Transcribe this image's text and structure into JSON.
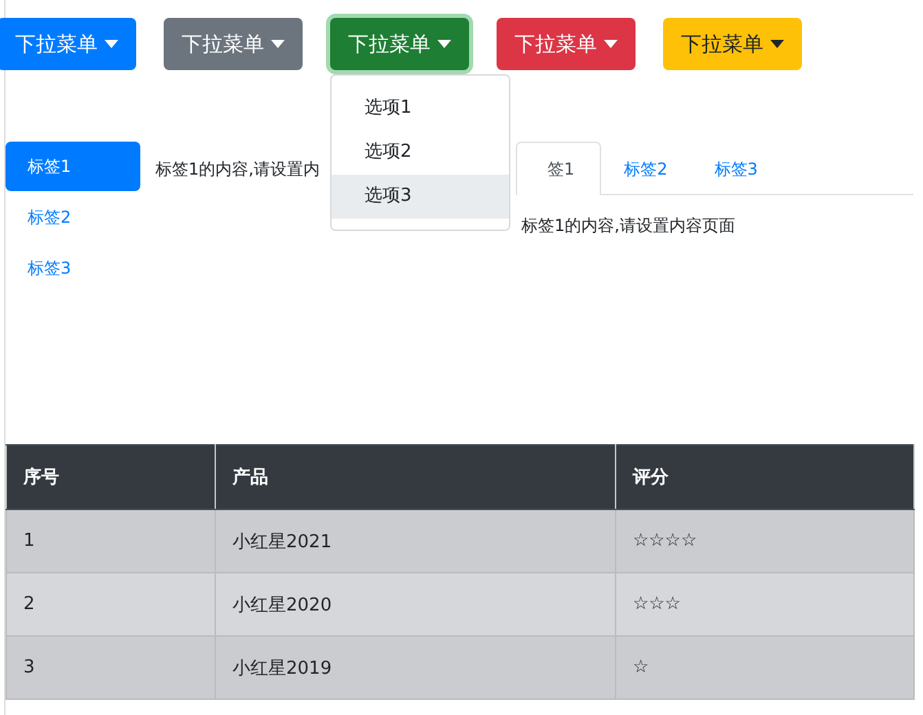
{
  "dropdowns": [
    {
      "label": "下拉菜单",
      "kind": "primary",
      "open": false
    },
    {
      "label": "下拉菜单",
      "kind": "secondary",
      "open": false
    },
    {
      "label": "下拉菜单",
      "kind": "success",
      "open": true
    },
    {
      "label": "下拉菜单",
      "kind": "danger",
      "open": false
    },
    {
      "label": "下拉菜单",
      "kind": "warning",
      "open": false
    }
  ],
  "dropdown_menu": {
    "items": [
      {
        "label": "选项1",
        "selected": false
      },
      {
        "label": "选项2",
        "selected": false
      },
      {
        "label": "选项3",
        "selected": true
      }
    ]
  },
  "pill_tabs": {
    "items": [
      {
        "label": "标签1",
        "selected": true
      },
      {
        "label": "标签2",
        "selected": false
      },
      {
        "label": "标签3",
        "selected": false
      }
    ],
    "content": "标签1的内容,请设置内"
  },
  "tabs": {
    "items": [
      {
        "label": "签1",
        "selected": true
      },
      {
        "label": "标签2",
        "selected": false
      },
      {
        "label": "标签3",
        "selected": false
      }
    ],
    "content": "标签1的内容,请设置内容页面"
  },
  "table": {
    "columns": [
      "序号",
      "产品",
      "评分"
    ],
    "rows": [
      {
        "cells": [
          "1",
          "小红星2021",
          "☆☆☆☆"
        ]
      },
      {
        "cells": [
          "2",
          "小红星2020",
          "☆☆☆"
        ]
      },
      {
        "cells": [
          "3",
          "小红星2019",
          "☆"
        ]
      }
    ]
  }
}
